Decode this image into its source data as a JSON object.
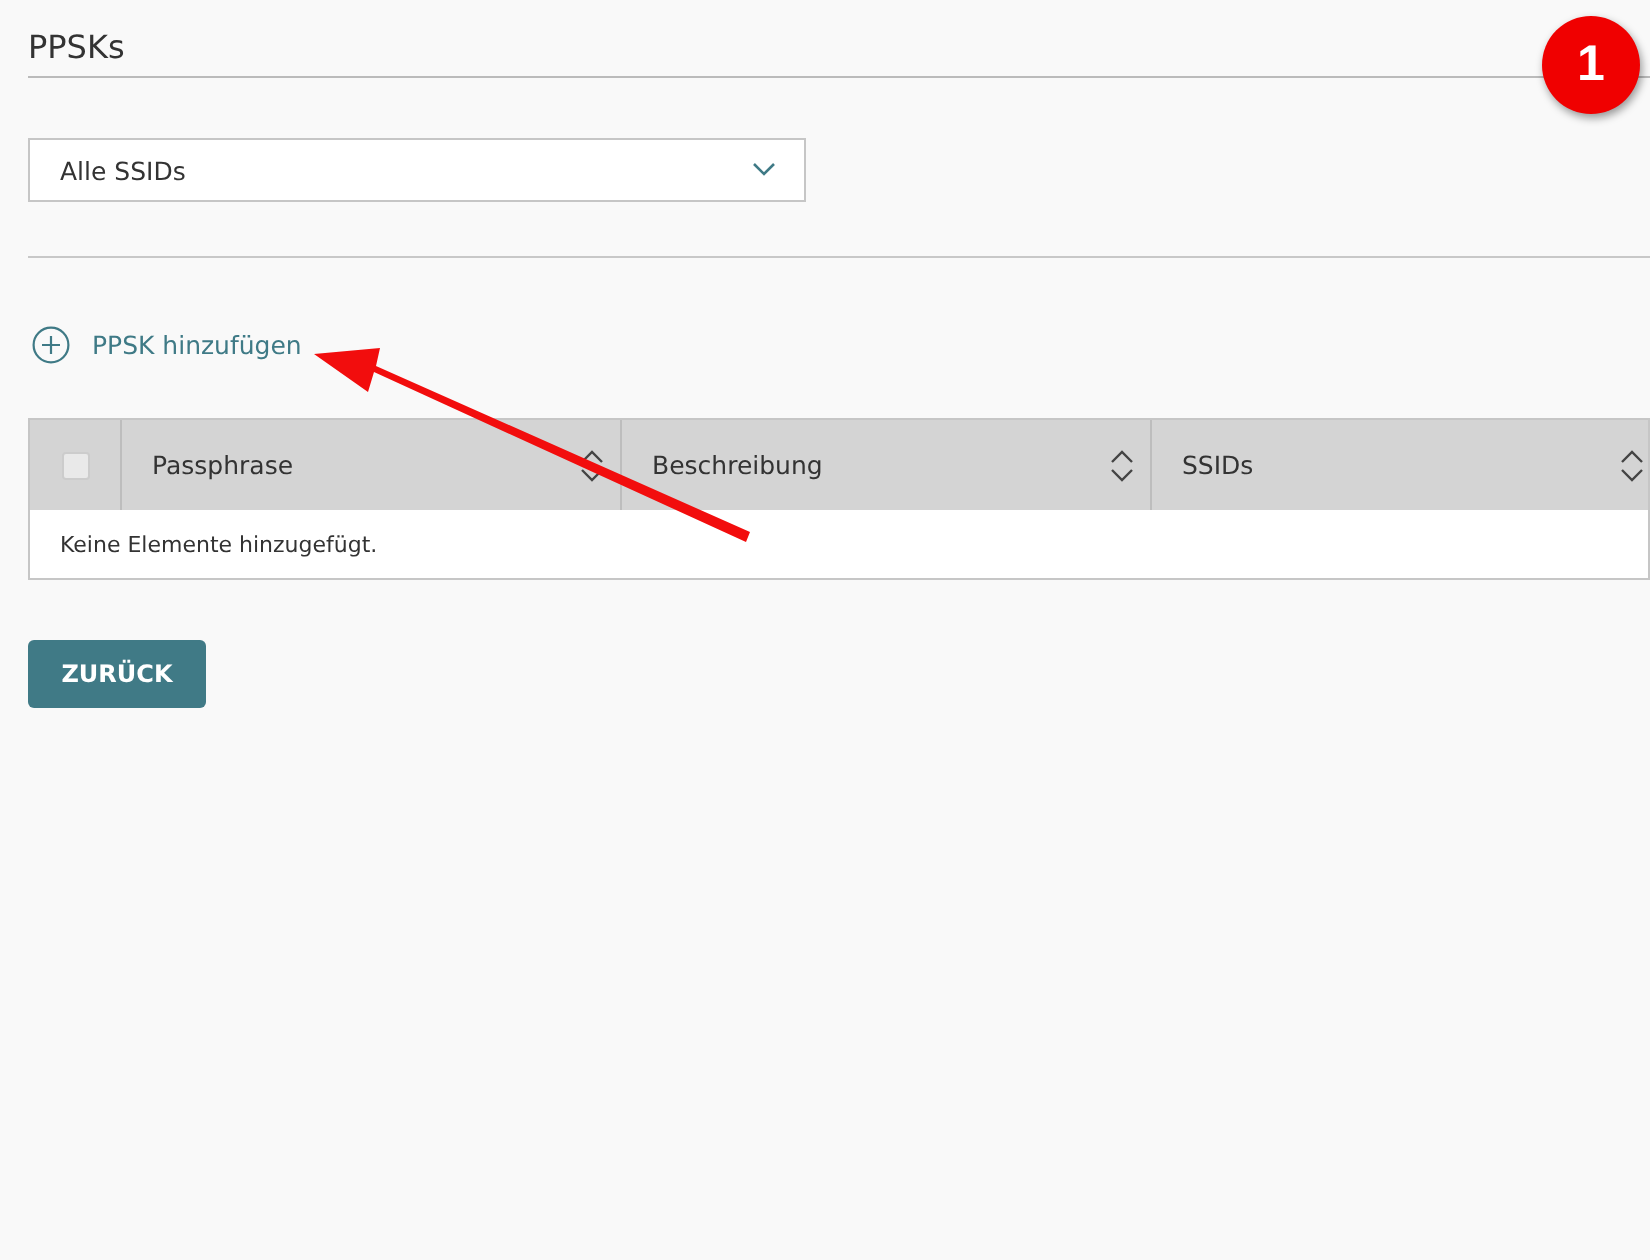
{
  "title": "PPSKs",
  "filter": {
    "value": "Alle SSIDs"
  },
  "add_link": {
    "label": "PPSK hinzufügen"
  },
  "table": {
    "select_all": {
      "checked": false
    },
    "columns": [
      {
        "label": "Passphrase"
      },
      {
        "label": "Beschreibung"
      },
      {
        "label": "SSIDs"
      }
    ],
    "empty_text": "Keine Elemente hinzugefügt."
  },
  "back_button": {
    "label": "ZURÜCK"
  },
  "annotation": {
    "badge": "1"
  }
}
